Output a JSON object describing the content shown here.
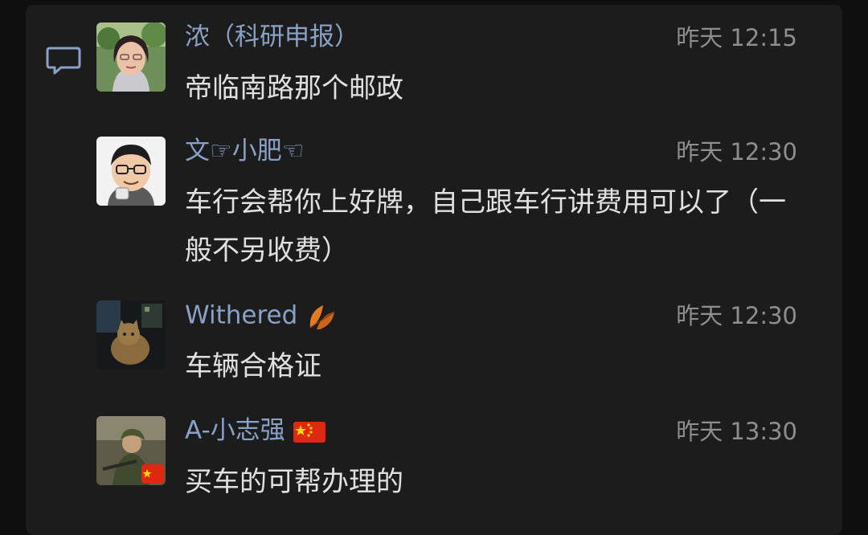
{
  "messages": [
    {
      "name": "浓（科研申报）",
      "name_suffix": "",
      "time": "昨天 12:15",
      "text": "帝临南路那个邮政",
      "avatar": "woman-photo-avatar"
    },
    {
      "name": "文☞小肥☜",
      "name_suffix": "",
      "time": "昨天 12:30",
      "text": "车行会帮你上好牌，自己跟车行讲费用可以了（一般不另收费）",
      "avatar": "cartoon-man-avatar"
    },
    {
      "name": "Withered",
      "name_suffix": "leaf-emoji",
      "time": "昨天 12:30",
      "text": "车辆合格证",
      "avatar": "cat-night-avatar"
    },
    {
      "name": "A-小志强",
      "name_suffix": "china-flag-emoji",
      "time": "昨天 13:30",
      "text": "买车的可帮办理的",
      "avatar": "soldier-avatar"
    }
  ],
  "colors": {
    "background": "#0f0f0f",
    "panel": "#1c1c1c",
    "name": "#8aa1c7",
    "time": "#8e8e8e",
    "text": "#e0e0e0"
  }
}
